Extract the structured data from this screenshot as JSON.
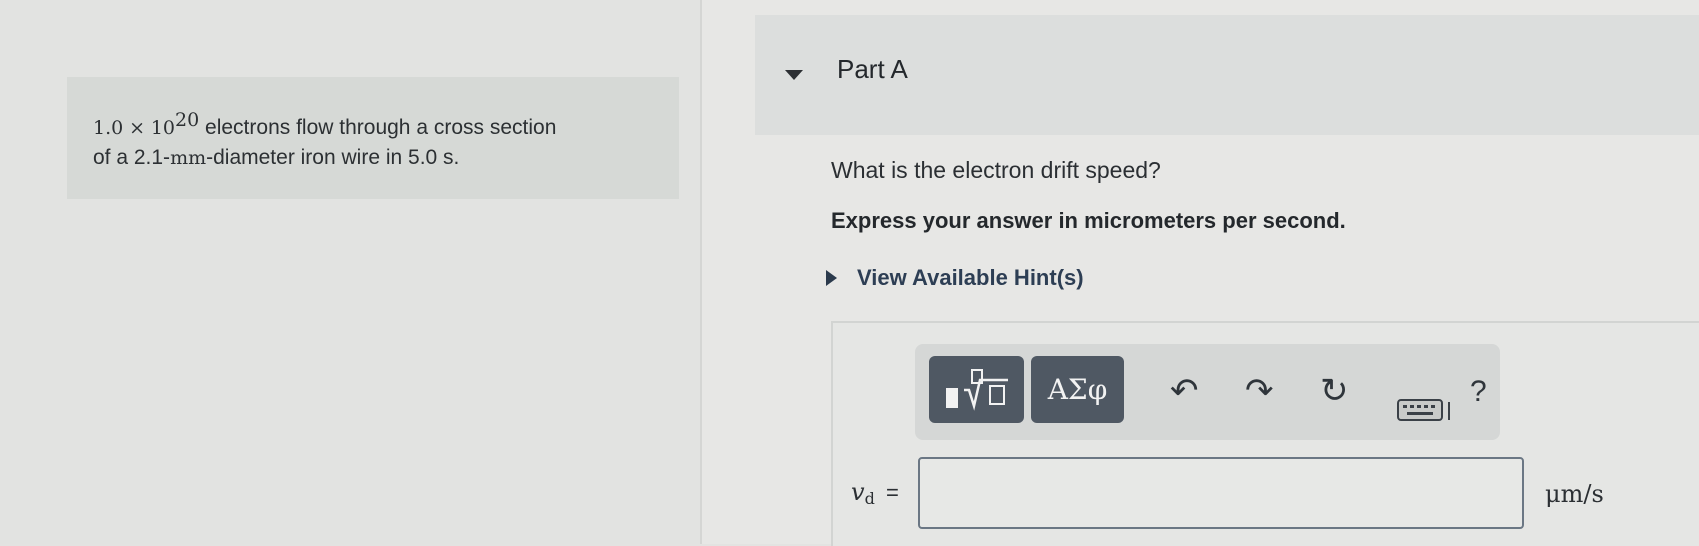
{
  "problem": {
    "coefficient": "1.0",
    "times": "×",
    "base": "10",
    "exponent": "20",
    "line1_rest": " electrons flow through a cross section",
    "line2_prefix": "of a 2.1-",
    "line2_unit": "mm",
    "line2_rest": "-diameter iron wire in 5.0 s."
  },
  "part": {
    "title": "Part A"
  },
  "question": "What is the electron drift speed?",
  "instruction": "Express your answer in micrometers per second.",
  "hint": {
    "label": "View Available Hint(s)"
  },
  "toolbar": {
    "symbols_label": "ΑΣφ",
    "undo_icon": "↶",
    "redo_icon": "↷",
    "reset_icon": "↻",
    "help_label": "?"
  },
  "answer": {
    "variable": "v",
    "variable_sub": "d",
    "equals": "=",
    "value": "",
    "unit": "μm/s"
  }
}
